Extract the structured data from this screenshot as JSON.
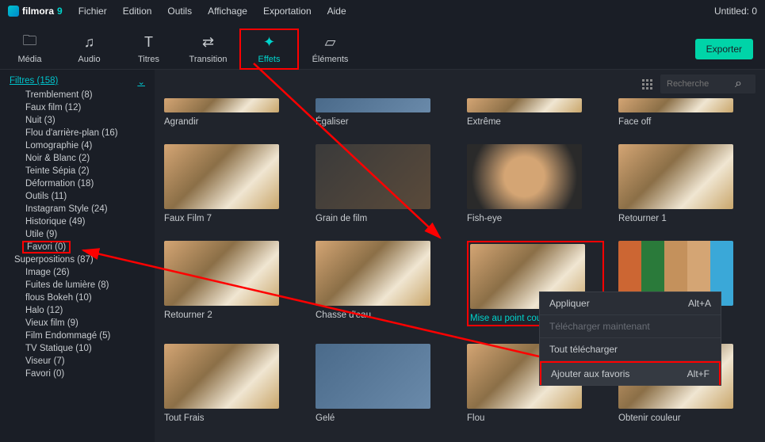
{
  "app": {
    "name": "filmora",
    "version": "9"
  },
  "menubar": [
    "Fichier",
    "Edition",
    "Outils",
    "Affichage",
    "Exportation",
    "Aide"
  ],
  "title": "Untitled:  0",
  "toolbar": [
    {
      "label": "Média",
      "icon": "folder"
    },
    {
      "label": "Audio",
      "icon": "music"
    },
    {
      "label": "Titres",
      "icon": "text"
    },
    {
      "label": "Transition",
      "icon": "transition"
    },
    {
      "label": "Effets",
      "icon": "effects",
      "active": true
    },
    {
      "label": "Éléments",
      "icon": "image"
    }
  ],
  "export_btn": "Exporter",
  "sidebar": {
    "header": "Filtres (158)",
    "items": [
      "Tremblement (8)",
      "Faux film (12)",
      "Nuit (3)",
      "Flou d'arrière-plan (16)",
      "Lomographie (4)",
      "Noir & Blanc (2)",
      "Teinte Sépia (2)",
      "Déformation (18)",
      "Outils (11)",
      "Instagram Style (24)",
      "Historique (49)",
      "Utile (9)",
      "Favori (0)"
    ],
    "group2_header": "Superpositions (87)",
    "group2_items": [
      "Image (26)",
      "Fuites de lumière (8)",
      "flous Bokeh (10)",
      "Halo (12)",
      "Vieux film (9)",
      "Film Endommagé (5)",
      "TV Statique (10)",
      "Viseur (7)",
      "Favori (0)"
    ]
  },
  "search": {
    "placeholder": "Recherche"
  },
  "effects": {
    "row0": [
      "Agrandir",
      "Égaliser",
      "Extrême",
      "Face off"
    ],
    "row1": [
      "Faux Film 7",
      "Grain de film",
      "Fish-eye",
      "Retourner 1"
    ],
    "row2": [
      "Retourner 2",
      "Chasse d'eau",
      "Mise au point couleur",
      ""
    ],
    "row3": [
      "Tout Frais",
      "Gelé",
      "Flou",
      "Obtenir couleur"
    ]
  },
  "context_menu": {
    "items": [
      {
        "label": "Appliquer",
        "shortcut": "Alt+A"
      },
      {
        "label": "Télécharger maintenant",
        "disabled": true
      },
      {
        "label": "Tout télécharger"
      },
      {
        "label": "Ajouter aux favoris",
        "shortcut": "Alt+F"
      }
    ]
  }
}
